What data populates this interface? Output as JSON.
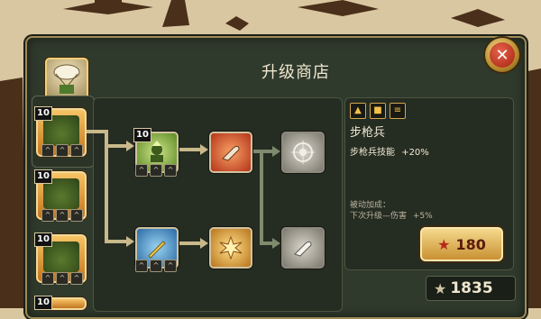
{
  "shop": {
    "title": "升级商店",
    "close_icon": "close-x-icon"
  },
  "header_unit": {
    "icon": "paratrooper-icon"
  },
  "units": [
    {
      "level": "10",
      "icon": "rifleman-icon",
      "ranks": [
        "^",
        "^",
        "^"
      ]
    },
    {
      "level": "10",
      "icon": "machine-gunner-icon",
      "ranks": [
        "^",
        "^",
        "^"
      ]
    },
    {
      "level": "10",
      "icon": "grenadier-icon",
      "ranks": [
        "^",
        "^",
        "^"
      ]
    },
    {
      "level": "10",
      "icon": "unit-icon"
    }
  ],
  "skills": {
    "top_row": [
      {
        "level": "10",
        "icon": "soldier-upgrade-icon",
        "ranks": [
          "^",
          "^",
          "^"
        ]
      },
      {
        "icon": "bullet-icon"
      },
      {
        "icon": "target-icon"
      }
    ],
    "bottom_row": [
      {
        "icon": "bayonet-icon",
        "ranks": [
          "^",
          "^",
          "^"
        ]
      },
      {
        "icon": "explosion-icon"
      },
      {
        "icon": "silver-bullet-icon"
      }
    ]
  },
  "info": {
    "icons": [
      "gun-icon",
      "crate-icon",
      "rifles-icon"
    ],
    "name": "步枪兵",
    "stat_label": "步枪兵技能",
    "stat_value": "+20%",
    "passive_title": "被动加成：",
    "passive_text": "下次升级—伤害",
    "passive_value": "+5%"
  },
  "purchase": {
    "price": "180"
  },
  "wallet": {
    "amount": "1835"
  },
  "colors": {
    "panel": "#2f3a2c",
    "gold": "#c99132",
    "accent_red": "#b7281a"
  }
}
